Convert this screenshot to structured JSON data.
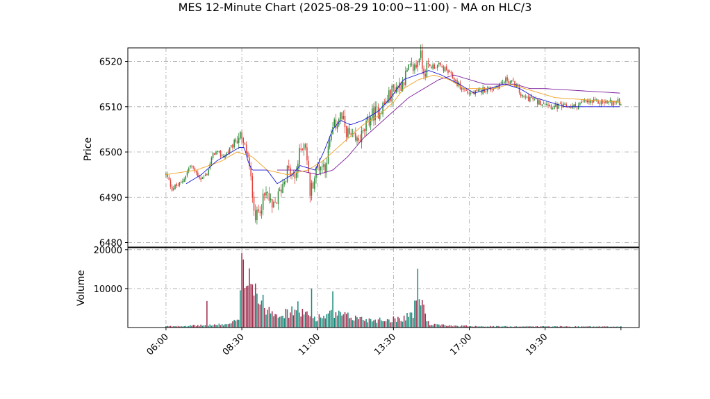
{
  "chart_data": {
    "type": "candlestick",
    "title": "MES 12-Minute Chart (2025-08-29 10:00~11:00) - MA on HLC/3",
    "price_panel": {
      "ylabel": "Price",
      "ylim": [
        6479,
        6523
      ],
      "yticks": [
        "6480",
        "6490",
        "6500",
        "6510",
        "6520"
      ],
      "grid": true
    },
    "volume_panel": {
      "ylabel": "Volume",
      "ylim": [
        0,
        20500
      ],
      "yticks": [
        "10000",
        "20000"
      ],
      "grid": true
    },
    "xaxis": {
      "tick_labels": [
        "06:00",
        "08:30",
        "11:00",
        "13:30",
        "17:00",
        "19:30"
      ],
      "tick_positions_min": [
        360,
        510,
        660,
        810,
        960,
        1110
      ],
      "range_min": [
        360,
        1260
      ],
      "label_rotation_deg": 45
    },
    "colors": {
      "up": "#2e8b3a",
      "down": "#e0423a",
      "ma_fast": "#1a1ad8",
      "ma_mid": "#f0a020",
      "ma_slow": "#7a1a9a",
      "vol_up": "#1a8a7a",
      "vol_down": "#a03050",
      "grid": "#a8a8a8"
    },
    "close_anchors": [
      [
        360,
        6495
      ],
      [
        372,
        6492
      ],
      [
        390,
        6493
      ],
      [
        408,
        6497
      ],
      [
        430,
        6494
      ],
      [
        440,
        6495
      ],
      [
        455,
        6500
      ],
      [
        475,
        6499
      ],
      [
        490,
        6501
      ],
      [
        505,
        6504
      ],
      [
        510,
        6502
      ],
      [
        520,
        6500
      ],
      [
        530,
        6492
      ],
      [
        538,
        6485
      ],
      [
        546,
        6488
      ],
      [
        560,
        6491
      ],
      [
        570,
        6487
      ],
      [
        585,
        6491
      ],
      [
        600,
        6496
      ],
      [
        615,
        6494
      ],
      [
        625,
        6500
      ],
      [
        635,
        6503
      ],
      [
        645,
        6491
      ],
      [
        660,
        6497
      ],
      [
        675,
        6497
      ],
      [
        690,
        6505
      ],
      [
        705,
        6508
      ],
      [
        720,
        6504
      ],
      [
        735,
        6502
      ],
      [
        750,
        6504
      ],
      [
        765,
        6508
      ],
      [
        780,
        6509
      ],
      [
        795,
        6511
      ],
      [
        810,
        6514
      ],
      [
        825,
        6515
      ],
      [
        840,
        6518
      ],
      [
        855,
        6519
      ],
      [
        862,
        6522
      ],
      [
        870,
        6518
      ],
      [
        885,
        6519
      ],
      [
        900,
        6519
      ],
      [
        915,
        6518
      ],
      [
        930,
        6516
      ],
      [
        945,
        6514
      ],
      [
        960,
        6513
      ],
      [
        975,
        6513
      ],
      [
        990,
        6514
      ],
      [
        1005,
        6514
      ],
      [
        1020,
        6515
      ],
      [
        1035,
        6516
      ],
      [
        1050,
        6515
      ],
      [
        1065,
        6512
      ],
      [
        1080,
        6512
      ],
      [
        1095,
        6511
      ],
      [
        1110,
        6511
      ],
      [
        1125,
        6510
      ],
      [
        1140,
        6510
      ],
      [
        1155,
        6510
      ],
      [
        1170,
        6510
      ],
      [
        1185,
        6511
      ],
      [
        1260,
        6511
      ]
    ],
    "ma_fast_anchors": [
      [
        400,
        6493
      ],
      [
        430,
        6495
      ],
      [
        460,
        6498
      ],
      [
        490,
        6500
      ],
      [
        505,
        6501
      ],
      [
        515,
        6501
      ],
      [
        522,
        6498
      ],
      [
        530,
        6496
      ],
      [
        560,
        6496
      ],
      [
        580,
        6493
      ],
      [
        595,
        6494
      ],
      [
        610,
        6495
      ],
      [
        625,
        6497
      ],
      [
        655,
        6496
      ],
      [
        672,
        6500
      ],
      [
        690,
        6505
      ],
      [
        705,
        6507
      ],
      [
        725,
        6506
      ],
      [
        750,
        6507
      ],
      [
        780,
        6509
      ],
      [
        805,
        6512
      ],
      [
        830,
        6516
      ],
      [
        855,
        6517
      ],
      [
        880,
        6518
      ],
      [
        905,
        6517
      ],
      [
        940,
        6515
      ],
      [
        970,
        6513
      ],
      [
        1000,
        6514
      ],
      [
        1030,
        6515
      ],
      [
        1060,
        6514
      ],
      [
        1090,
        6512
      ],
      [
        1120,
        6511
      ],
      [
        1150,
        6510
      ],
      [
        1260,
        6510
      ]
    ],
    "ma_mid_anchors": [
      [
        360,
        6495
      ],
      [
        420,
        6496
      ],
      [
        470,
        6498
      ],
      [
        500,
        6500
      ],
      [
        530,
        6499
      ],
      [
        560,
        6496
      ],
      [
        600,
        6495
      ],
      [
        640,
        6496
      ],
      [
        670,
        6498
      ],
      [
        700,
        6501
      ],
      [
        720,
        6503
      ],
      [
        750,
        6506
      ],
      [
        780,
        6508
      ],
      [
        810,
        6511
      ],
      [
        830,
        6514
      ],
      [
        860,
        6516
      ],
      [
        890,
        6517
      ],
      [
        920,
        6516
      ],
      [
        950,
        6514
      ],
      [
        980,
        6514
      ],
      [
        1010,
        6514
      ],
      [
        1040,
        6515
      ],
      [
        1070,
        6514
      ],
      [
        1100,
        6513
      ],
      [
        1130,
        6512
      ],
      [
        1260,
        6511
      ]
    ],
    "ma_slow_anchors": [
      [
        580,
        6496
      ],
      [
        620,
        6496
      ],
      [
        660,
        6495
      ],
      [
        690,
        6496
      ],
      [
        720,
        6499
      ],
      [
        750,
        6503
      ],
      [
        780,
        6506
      ],
      [
        810,
        6509
      ],
      [
        840,
        6512
      ],
      [
        870,
        6514
      ],
      [
        900,
        6516
      ],
      [
        930,
        6517
      ],
      [
        960,
        6516
      ],
      [
        990,
        6515
      ],
      [
        1020,
        6515
      ],
      [
        1050,
        6515
      ],
      [
        1080,
        6514
      ],
      [
        1110,
        6514
      ],
      [
        1260,
        6513
      ]
    ],
    "volume_anchors": [
      [
        360,
        300
      ],
      [
        420,
        500
      ],
      [
        480,
        800
      ],
      [
        495,
        1500
      ],
      [
        505,
        2000
      ],
      [
        510,
        15000
      ],
      [
        518,
        12000
      ],
      [
        525,
        14500
      ],
      [
        535,
        10000
      ],
      [
        545,
        7000
      ],
      [
        560,
        5000
      ],
      [
        580,
        4000
      ],
      [
        600,
        3500
      ],
      [
        620,
        5000
      ],
      [
        640,
        3000
      ],
      [
        660,
        2500
      ],
      [
        690,
        3500
      ],
      [
        720,
        2800
      ],
      [
        760,
        2000
      ],
      [
        800,
        2000
      ],
      [
        830,
        2500
      ],
      [
        850,
        4000
      ],
      [
        860,
        9000
      ],
      [
        868,
        6000
      ],
      [
        880,
        800
      ],
      [
        920,
        500
      ],
      [
        1000,
        300
      ],
      [
        1260,
        250
      ]
    ],
    "volume_spikes": [
      [
        442,
        6800
      ],
      [
        510,
        19200
      ],
      [
        525,
        15200
      ],
      [
        537,
        11300
      ],
      [
        648,
        10000
      ],
      [
        690,
        9300
      ],
      [
        859,
        15100
      ]
    ]
  }
}
